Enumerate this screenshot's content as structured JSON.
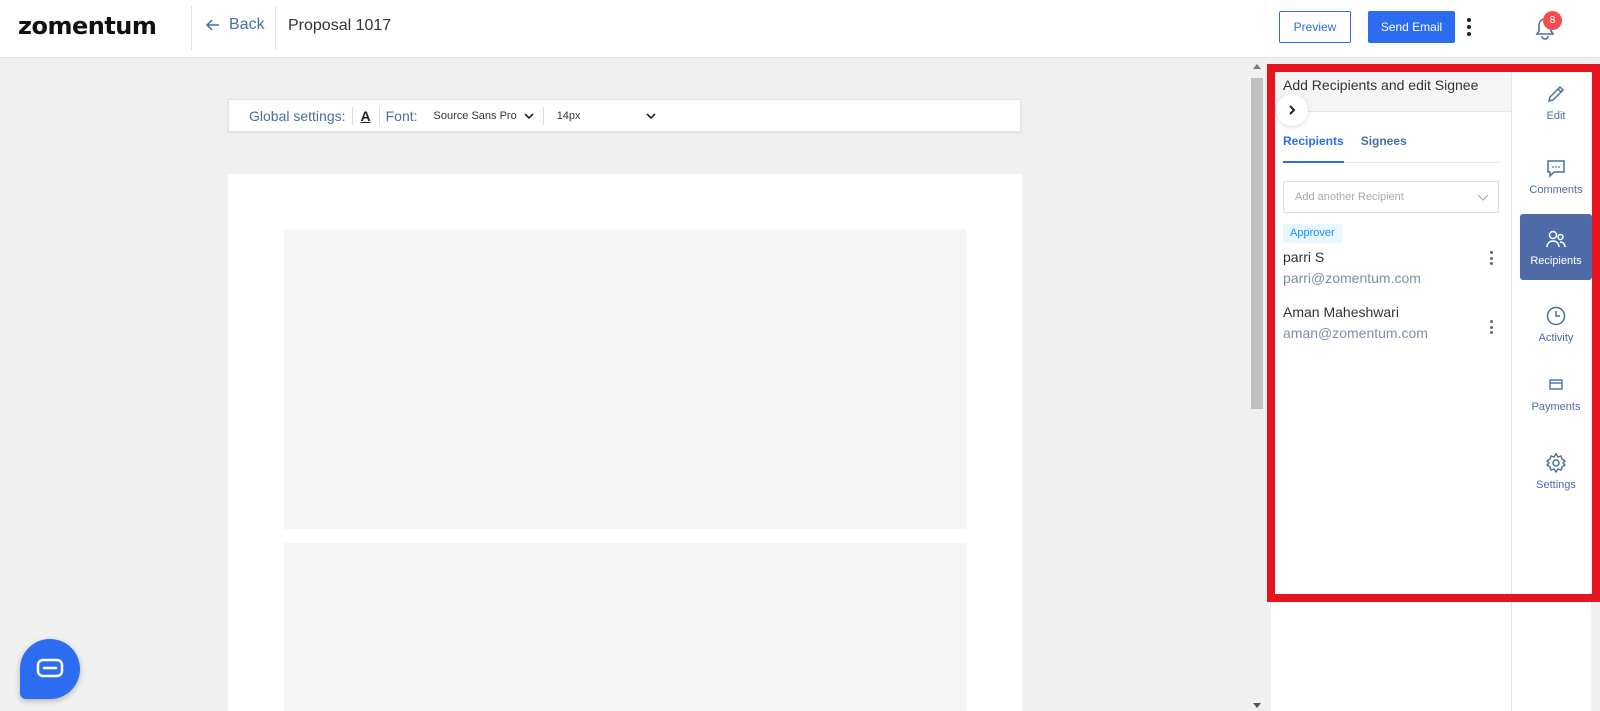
{
  "header": {
    "logo": "zomentum",
    "back_label": "Back",
    "proposal_title": "Proposal 1017",
    "preview_label": "Preview",
    "send_email_label": "Send Email",
    "notification_count": "8"
  },
  "toolbar": {
    "global_settings_label": "Global settings:",
    "text_color_glyph": "A",
    "font_label": "Font:",
    "font_value": "Source Sans Pro",
    "size_value": "14px"
  },
  "panel": {
    "title": "Add Recipients and edit Signee",
    "tabs": [
      {
        "label": "Recipients",
        "active": true
      },
      {
        "label": "Signees",
        "active": false
      }
    ],
    "recipient_placeholder": "Add another Recipient",
    "approver_tag": "Approver",
    "recipients": [
      {
        "name": "parri S",
        "email": "parri@zomentum.com"
      },
      {
        "name": "Aman Maheshwari",
        "email": "aman@zomentum.com"
      }
    ]
  },
  "rail": {
    "items": [
      {
        "label": "Edit",
        "icon": "pencil-icon"
      },
      {
        "label": "Comments",
        "icon": "comment-icon"
      },
      {
        "label": "Recipients",
        "icon": "users-icon",
        "active": true
      },
      {
        "label": "Activity",
        "icon": "clock-icon"
      },
      {
        "label": "Payments",
        "icon": "card-icon"
      },
      {
        "label": "Settings",
        "icon": "gear-icon"
      }
    ]
  },
  "colors": {
    "accent": "#2b6cf0",
    "rail_active": "#4f6ba8",
    "highlight": "#e5141f",
    "badge": "#f44d4d"
  }
}
